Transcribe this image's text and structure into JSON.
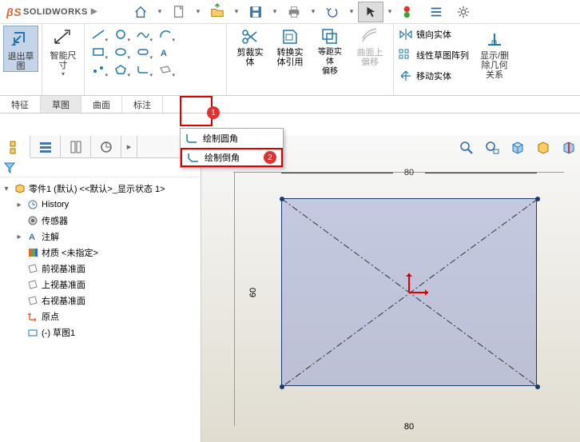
{
  "app": {
    "brand_ds": "DS",
    "brand_name": "SOLIDWORKS"
  },
  "ribbon": {
    "exit_sketch": "退出草\n图",
    "smart_dim": "智能尺\n寸",
    "trim": "剪裁实\n体",
    "convert": "转换实\n体引用",
    "offset": "等距实\n体\n偏移",
    "surface_offset": "曲面上\n偏移",
    "mirror": "镜向实体",
    "pattern": "线性草图阵列",
    "move": "移动实体",
    "show_rel": "显示/删\n除几何\n关系"
  },
  "tabs": {
    "t0": "特征",
    "t1": "草图",
    "t2": "曲面",
    "t3": "标注"
  },
  "dropdown": {
    "fillet": "绘制圆角",
    "chamfer": "绘制倒角",
    "badge1": "1",
    "badge2": "2"
  },
  "tree": {
    "root": "零件1 (默认) <<默认>_显示状态 1>",
    "history": "History",
    "sensors": "传感器",
    "annotations": "注解",
    "material": "材质 <未指定>",
    "front": "前视基准面",
    "top": "上视基准面",
    "right": "右视基准面",
    "origin": "原点",
    "sketch": "(-) 草图1"
  },
  "dims": {
    "width": "80",
    "height": "60",
    "width2": "80"
  }
}
